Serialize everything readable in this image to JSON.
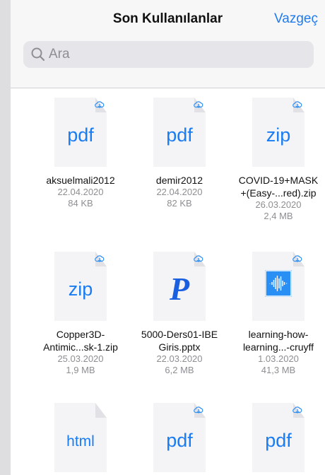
{
  "header": {
    "title": "Son Kullanılanlar",
    "cancel_label": "Vazgeç"
  },
  "search": {
    "placeholder": "Ara",
    "icon": "search-icon"
  },
  "colors": {
    "accent": "#1e7bf1",
    "cloud_icon": "#2a8ff5"
  },
  "files": [
    {
      "type": "pdf",
      "name1": "aksuelmali2012",
      "name2": "",
      "date": "22.04.2020",
      "size": "84 KB",
      "icon": "cloud-download-icon"
    },
    {
      "type": "pdf",
      "name1": "demir2012",
      "name2": "",
      "date": "22.04.2020",
      "size": "82 KB",
      "icon": "cloud-download-icon"
    },
    {
      "type": "zip",
      "name1": "COVID-19+MASK",
      "name2": "+(Easy-...red).zip",
      "date": "26.03.2020",
      "size": "2,4 MB",
      "icon": "cloud-download-icon"
    },
    {
      "type": "zip",
      "name1": "Copper3D-",
      "name2": "Antimic...sk-1.zip",
      "date": "25.03.2020",
      "size": "1,9 MB",
      "icon": "cloud-download-icon"
    },
    {
      "type": "pptx",
      "name1": "5000-Ders01-IBE",
      "name2": "Giris.pptx",
      "date": "22.03.2020",
      "size": "6,2 MB",
      "icon": "cloud-download-icon"
    },
    {
      "type": "audio",
      "name1": "learning-how-",
      "name2": "learning...-cruyff",
      "date": "1.03.2020",
      "size": "41,3 MB",
      "icon": "cloud-download-icon"
    },
    {
      "type": "html",
      "name1": "",
      "name2": "",
      "date": "",
      "size": "",
      "icon": ""
    },
    {
      "type": "pdf",
      "name1": "",
      "name2": "",
      "date": "",
      "size": "",
      "icon": "cloud-download-icon"
    },
    {
      "type": "pdf",
      "name1": "",
      "name2": "",
      "date": "",
      "size": "",
      "icon": "cloud-download-icon"
    }
  ],
  "labels": {
    "pdf": "pdf",
    "zip": "zip",
    "html": "html",
    "ppt": "P"
  }
}
